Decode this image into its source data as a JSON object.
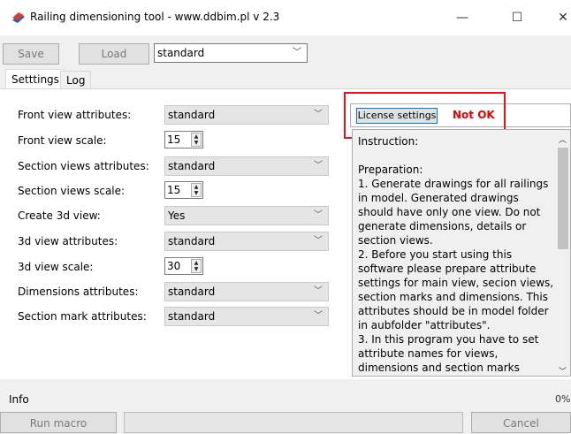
{
  "window": {
    "title": "Railing dimensioning tool - www.ddbim.pl v 2.3",
    "minimize": "—",
    "maximize": "☐",
    "close": "✕"
  },
  "toolbar": {
    "save_label": "Save",
    "load_label": "Load",
    "profile_value": "standard"
  },
  "tabs": [
    {
      "label": "Setttings",
      "active": true
    },
    {
      "label": "Log",
      "active": false
    }
  ],
  "settings": {
    "front_view_attributes": {
      "label": "Front view attributes:",
      "value": "standard"
    },
    "front_view_scale": {
      "label": "Front view scale:",
      "value": "15"
    },
    "section_views_attributes": {
      "label": "Section views attributes:",
      "value": "standard"
    },
    "section_views_scale": {
      "label": "Section views scale:",
      "value": "15"
    },
    "create_3d_view": {
      "label": "Create 3d view:",
      "value": "Yes"
    },
    "view3d_attributes": {
      "label": "3d view attributes:",
      "value": "standard"
    },
    "view3d_scale": {
      "label": "3d view scale:",
      "value": "30"
    },
    "dimensions_attributes": {
      "label": "Dimensions attributes:",
      "value": "standard"
    },
    "section_mark_attributes": {
      "label": "Section mark attributes:",
      "value": "standard"
    }
  },
  "license": {
    "button_label": "License settings",
    "status": "Not OK",
    "status_color": "#e60000"
  },
  "instructions": {
    "text": "Instruction:\n\nPreparation:\n1. Generate drawings for all railings in model. Generated drawings should have only one view. Do not generate dimensions, details or section views.\n2. Before you start using this software please prepare attribute settings for main view, secion views, section marks and dimensions. This attributes should be in model folder in aubfolder \"attributes\".\n3. In this program you have to set attribute names for views, dimensions and section marks before you start. Otherwise the \"standard\" attributes will"
  },
  "footer": {
    "info_label": "Info",
    "progress_percent": "0%",
    "run_label": "Run macro",
    "cancel_label": "Cancel"
  },
  "colors": {
    "highlight": "#e8121d",
    "accent_border": "#0078d7"
  },
  "icons": {
    "app": "railing-tool-icon",
    "dropdown": "chevron-down-icon",
    "spin_up": "spin-up-icon",
    "spin_down": "spin-down-icon"
  }
}
